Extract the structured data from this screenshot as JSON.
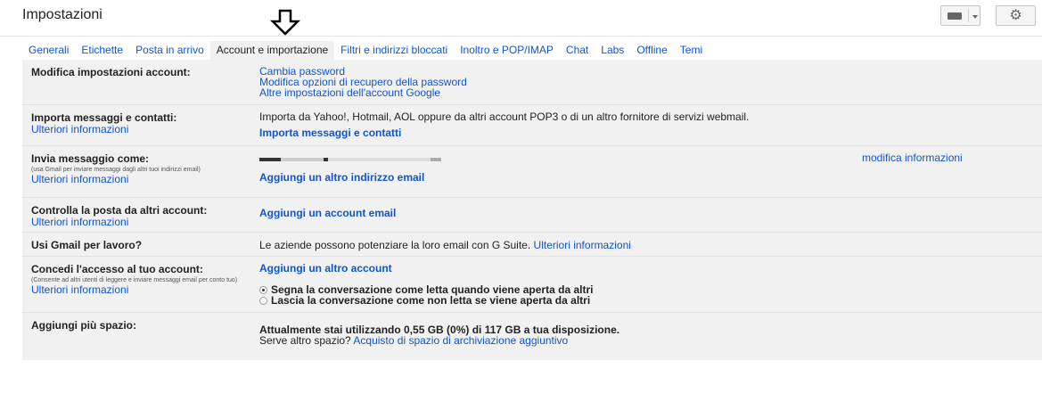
{
  "header": {
    "title": "Impostazioni",
    "keyboard_icon": "keyboard-icon",
    "gear_icon": "gear-icon"
  },
  "tabs": [
    {
      "label": "Generali"
    },
    {
      "label": "Etichette"
    },
    {
      "label": "Posta in arrivo"
    },
    {
      "label": "Account e importazione",
      "active": true
    },
    {
      "label": "Filtri e indirizzi bloccati"
    },
    {
      "label": "Inoltro e POP/IMAP"
    },
    {
      "label": "Chat"
    },
    {
      "label": "Labs"
    },
    {
      "label": "Offline"
    },
    {
      "label": "Temi"
    }
  ],
  "rows": {
    "account": {
      "label": "Modifica impostazioni account:",
      "links": [
        "Cambia password",
        "Modifica opzioni di recupero della password",
        "Altre impostazioni dell'account Google"
      ]
    },
    "import": {
      "label": "Importa messaggi e contatti:",
      "more": "Ulteriori informazioni",
      "description": "Importa da Yahoo!, Hotmail, AOL oppure da altri account POP3 o di un altro fornitore di servizi webmail.",
      "action": "Importa messaggi e contatti"
    },
    "send_as": {
      "label": "Invia messaggio come:",
      "small": "(usa Gmail per inviare messaggi dagli altri tuoi indirizzi email)",
      "more": "Ulteriori informazioni",
      "action": "Aggiungi un altro indirizzo email",
      "edit": "modifica informazioni"
    },
    "check_mail": {
      "label": "Controlla la posta da altri account:",
      "more": "Ulteriori informazioni",
      "action": "Aggiungi un account email"
    },
    "work": {
      "label": "Usi Gmail per lavoro?",
      "text": "Le aziende possono potenziare la loro email con G Suite.",
      "more": "Ulteriori informazioni"
    },
    "grant": {
      "label": "Concedi l'accesso al tuo account:",
      "small": "(Consente ad altri utenti di leggere e inviare messaggi email per conto tuo)",
      "more": "Ulteriori informazioni",
      "action": "Aggiungi un altro account",
      "option1": "Segna la conversazione come letta quando viene aperta da altri",
      "option2": "Lascia la conversazione come non letta se viene aperta da altri",
      "selected": 1
    },
    "storage": {
      "label": "Aggiungi più spazio:",
      "usage": "Attualmente stai utilizzando 0,55 GB (0%) di 117 GB a tua disposizione.",
      "prompt": "Serve altro spazio?",
      "link": "Acquisto di spazio di archiviazione aggiuntivo"
    }
  }
}
